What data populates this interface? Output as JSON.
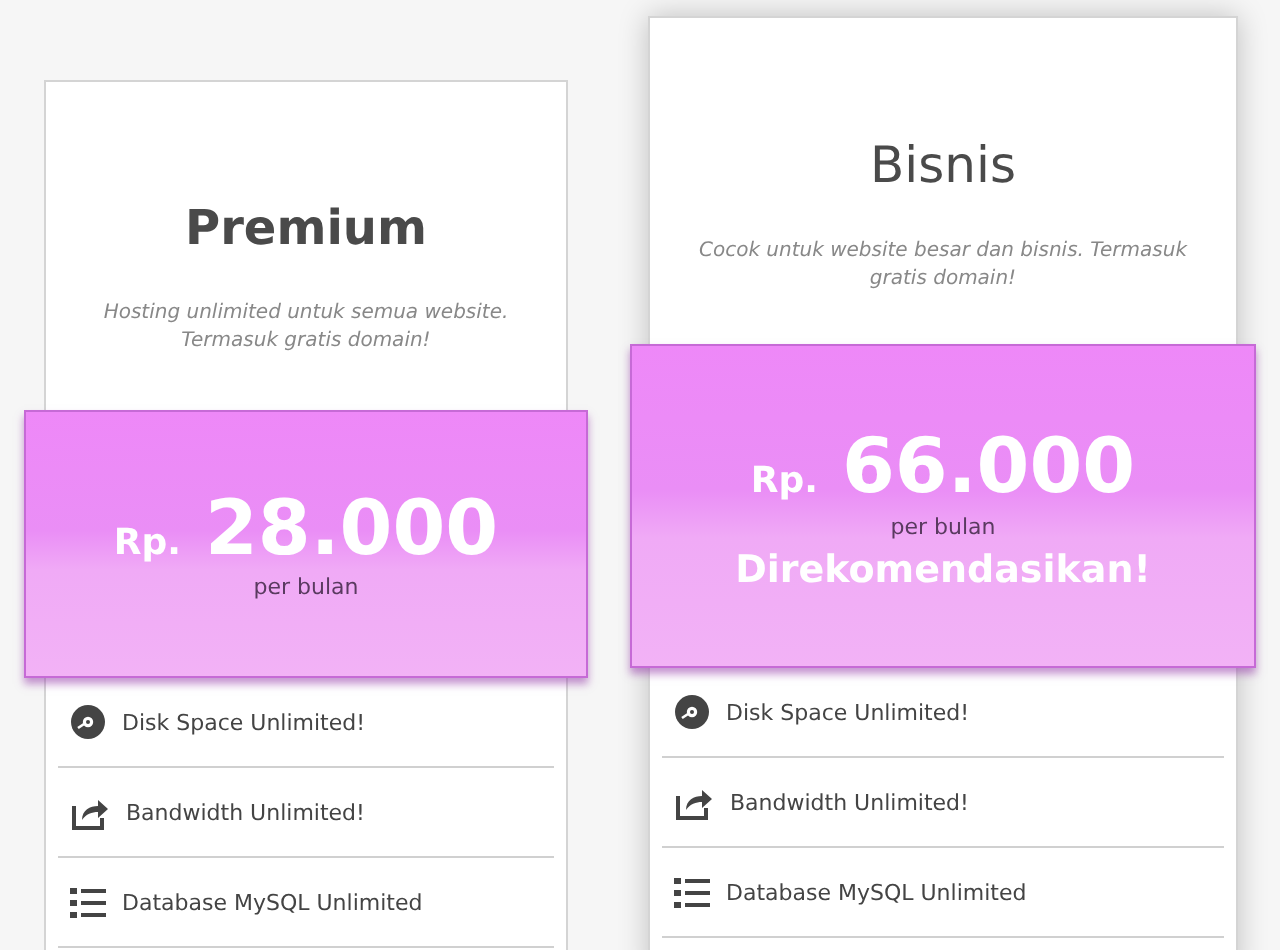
{
  "plans": [
    {
      "name": "Premium",
      "featured": false,
      "description": "Hosting unlimited untuk semua website. Termasuk gratis domain!",
      "currency": "Rp.",
      "price": "28.000",
      "period": "per bulan",
      "features": [
        {
          "kind": "disk",
          "label": "Disk Space Unlimited!"
        },
        {
          "kind": "share",
          "label": "Bandwidth Unlimited!"
        },
        {
          "kind": "list",
          "label": "Database MySQL Unlimited"
        }
      ]
    },
    {
      "name": "Bisnis",
      "featured": true,
      "description": "Cocok untuk website besar dan bisnis. Termasuk gratis domain!",
      "currency": "Rp.",
      "price": "66.000",
      "period": "per bulan",
      "badge": "Direkomendasikan!",
      "features": [
        {
          "kind": "disk",
          "label": "Disk Space Unlimited!"
        },
        {
          "kind": "share",
          "label": "Bandwidth Unlimited!"
        },
        {
          "kind": "list",
          "label": "Database MySQL Unlimited"
        }
      ]
    }
  ]
}
